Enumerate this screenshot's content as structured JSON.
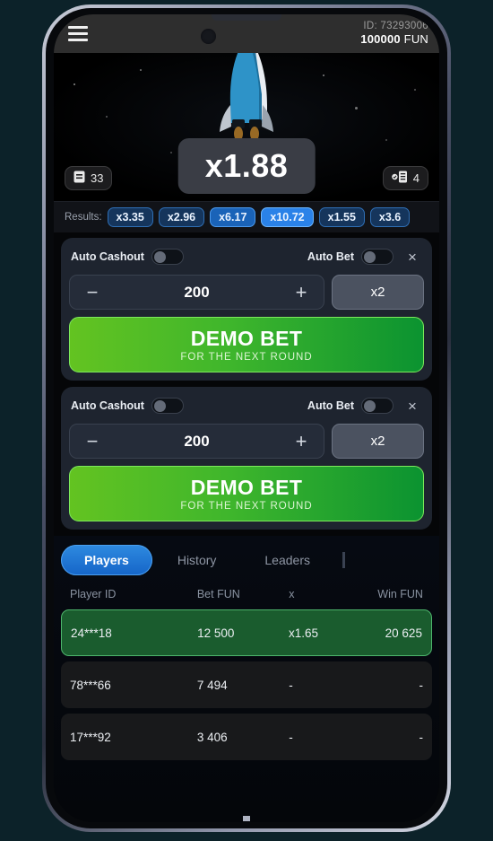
{
  "topbar": {
    "menu_icon": "hamburger-menu-icon",
    "player_id": "ID: 73293006",
    "balance": "100000",
    "currency": "FUN"
  },
  "game": {
    "multiplier": "x1.88",
    "rocket_icon": "rocket-icon",
    "left_counter": {
      "icon": "list-icon",
      "value": "33"
    },
    "right_counter": {
      "icon": "checked-list-icon",
      "value": "4"
    }
  },
  "results": {
    "label": "Results:",
    "items": [
      {
        "value": "x3.35",
        "style": "normal"
      },
      {
        "value": "x2.96",
        "style": "normal"
      },
      {
        "value": "x6.17",
        "style": "hi"
      },
      {
        "value": "x10.72",
        "style": "hi2"
      },
      {
        "value": "x1.55",
        "style": "normal"
      },
      {
        "value": "x3.6",
        "style": "normal"
      }
    ]
  },
  "bet_panels": [
    {
      "auto_cashout_label": "Auto Cashout",
      "auto_cashout_on": false,
      "auto_bet_label": "Auto Bet",
      "auto_bet_on": false,
      "close_label": "×",
      "decrement_label": "−",
      "amount": "200",
      "increment_label": "+",
      "multiply_label": "x2",
      "action_title": "DEMO BET",
      "action_subtitle": "FOR THE NEXT ROUND"
    },
    {
      "auto_cashout_label": "Auto Cashout",
      "auto_cashout_on": false,
      "auto_bet_label": "Auto Bet",
      "auto_bet_on": false,
      "close_label": "×",
      "decrement_label": "−",
      "amount": "200",
      "increment_label": "+",
      "multiply_label": "x2",
      "action_title": "DEMO BET",
      "action_subtitle": "FOR THE NEXT ROUND"
    }
  ],
  "tabs": [
    {
      "label": "Players",
      "active": true
    },
    {
      "label": "History",
      "active": false
    },
    {
      "label": "Leaders",
      "active": false
    }
  ],
  "table": {
    "columns": [
      "Player ID",
      "Bet  FUN",
      "x",
      "Win  FUN"
    ],
    "rows": [
      {
        "player": "24***18",
        "bet": "12 500",
        "mult": "x1.65",
        "win": "20 625",
        "won": true
      },
      {
        "player": "78***66",
        "bet": "7 494",
        "mult": "-",
        "win": "-",
        "won": false
      },
      {
        "player": "17***92",
        "bet": "3 406",
        "mult": "-",
        "win": "-",
        "won": false
      }
    ]
  },
  "colors": {
    "accent_blue": "#1565c8",
    "bet_green": "#3fb62c",
    "win_green": "#1a5c2e",
    "panel_bg": "#1e242f",
    "page_bg": "#0c2229"
  }
}
